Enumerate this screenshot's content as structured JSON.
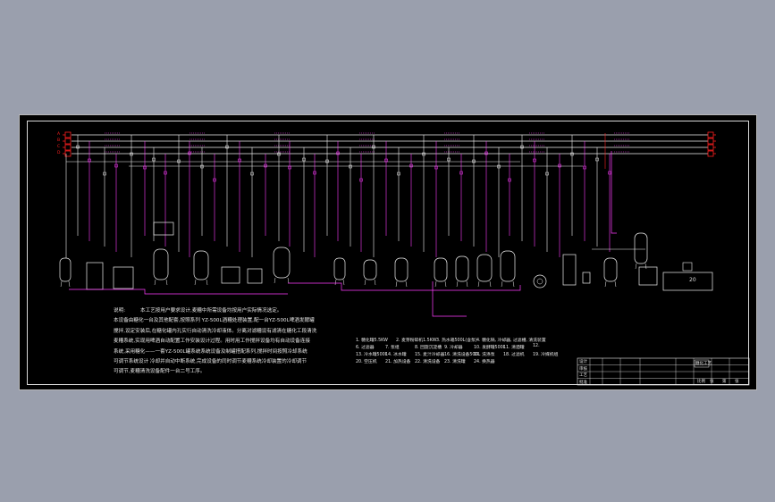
{
  "drawing": {
    "note_label": "说明:",
    "note_lines": [
      "本工艺按用户要求设计,麦糟中所需设备均按用户实际情况选定。",
      "本设备由糖化一台及其他配套,按照系列 YZ-500L酒糟处理装置,配一台YZ-500L啤酒发酵罐",
      "搅拌,设定安装后,在糖化罐内孔实行自动清洗冷却液体。分离对滤糟设有滤清在糖化工段清洗",
      "麦糟系统,实现用啤酒自动配置工作安装设计过程。用时用工作搅拌设备均有自动设备连接",
      "系统,采用糖化——一套YZ-500L罐系统系统设备及制罐搭配系列,搅拌时间按照冷却系统",
      "可调节系统设计 冷却并自动中断系统,完成设备的同时调节麦糟系统冷却装置的冷却调节",
      "可调节,麦糟清洗设备配件一台二号工序。"
    ],
    "legend_items": [
      "1. 糖化罐5.5KW",
      "2. 麦芽粉碎机1.5KW",
      "3. 热水箱500L(含泵)",
      "4. 糖化锅, 冷却器, 过滤槽, 清洗装置",
      "6. 过滤器",
      "7. 泵组",
      "8. 回旋沉淀槽",
      "9. 冷却器",
      "10. 发酵罐500L",
      "11. 清酒罐",
      "12.",
      "13. 冷水罐500L",
      "14. 冰水罐",
      "15. 麦汁冷却器",
      "16. 清洗设备500L",
      "17. 洗涤泵",
      "18. 过滤机",
      "19. 冷媒机组",
      "20. 空压机",
      "21. 加热设备",
      "22. 清洗设备",
      "23. 清洗罐",
      "24. 换热器"
    ],
    "pipe_tags": [
      "A",
      "B",
      "C",
      "D"
    ],
    "equipment_number": "20",
    "title_block": {
      "labels": [
        "设计",
        "审核",
        "工艺",
        "批准"
      ],
      "title_small": "糖化工艺",
      "sheet_info": [
        "比例",
        "张",
        "第",
        "张"
      ]
    },
    "colors": {
      "background": "#9a9fad",
      "sheet": "#000000",
      "pipe_magenta": "#ff3dff",
      "equipment_white": "#f0f0f0",
      "tag_red": "#ff2020",
      "text": "#e6e6e6"
    }
  }
}
